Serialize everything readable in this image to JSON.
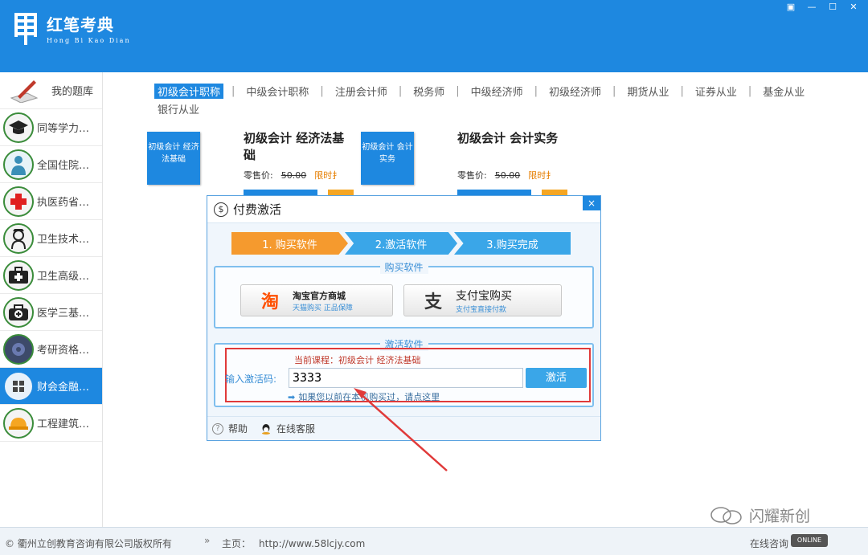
{
  "app": {
    "name_cn": "红笔考典",
    "name_en": "Hong Bi Kao Dian",
    "window_controls": [
      "▣",
      "—",
      "☐",
      "✕"
    ]
  },
  "sidebar": {
    "items": [
      {
        "label": "我的题库",
        "icon": "pen-paper-icon"
      },
      {
        "label": "同等学力…",
        "icon": "graduation-cap-icon"
      },
      {
        "label": "全国住院…",
        "icon": "doctor-icon"
      },
      {
        "label": "执医药省…",
        "icon": "red-cross-icon"
      },
      {
        "label": "卫生技术…",
        "icon": "nurse-icon"
      },
      {
        "label": "卫生高级…",
        "icon": "first-aid-kit-icon"
      },
      {
        "label": "医学三基…",
        "icon": "medical-bag-icon"
      },
      {
        "label": "考研资格…",
        "icon": "gear-icon"
      },
      {
        "label": "财会金融…",
        "icon": "calculator-icon",
        "active": true
      },
      {
        "label": "工程建筑…",
        "icon": "hard-hat-icon"
      }
    ]
  },
  "tabs": {
    "row1": [
      "初级会计职称",
      "中级会计职称",
      "注册会计师",
      "税务师",
      "中级经济师",
      "初级经济师",
      "期货从业",
      "证券从业",
      "基金从业"
    ],
    "row2": [
      "银行从业"
    ],
    "active_index": 0
  },
  "products": [
    {
      "cover": "初级会计 经济法基础",
      "title": "初级会计 经济法基础",
      "price_label": "零售价:",
      "old_price": "50.00",
      "tag": "限时扌"
    },
    {
      "cover": "初级会计 会计实务",
      "title": "初级会计 会计实务",
      "price_label": "零售价:",
      "old_price": "50.00",
      "tag": "限时扌"
    }
  ],
  "dialog": {
    "title": "付费激活",
    "title_icon": "$",
    "close": "×",
    "steps": [
      "1. 购买软件",
      "2.激活软件",
      "3.购买完成"
    ],
    "buy_section": {
      "legend": "购买软件",
      "taobao": {
        "icon": "淘",
        "title": "淘宝官方商城",
        "sub": "天猫购买  正品保障"
      },
      "alipay": {
        "icon": "支",
        "title": "支付宝购买",
        "sub": "支付宝直接付款"
      }
    },
    "activate_section": {
      "legend": "激活软件",
      "current_course": "当前课程：初级会计 经济法基础",
      "code_label": "输入激活码:",
      "code_value": "3333",
      "activate_button": "激活",
      "hint": "如果您以前在本机购买过，请点这里"
    },
    "footer": {
      "help": "帮助",
      "service": "在线客服"
    }
  },
  "footer": {
    "copyright": "© 衢州立创教育咨询有限公司版权所有",
    "sep": "»",
    "home_label": "主页：",
    "home_url": "http://www.58lcjy.com",
    "online": "在线咨询",
    "online_badge": "ONLINE"
  },
  "watermark": "闪耀新创",
  "colors": {
    "primary": "#1e88e0",
    "step_active": "#f59a2e",
    "highlight": "#e03a3a"
  }
}
